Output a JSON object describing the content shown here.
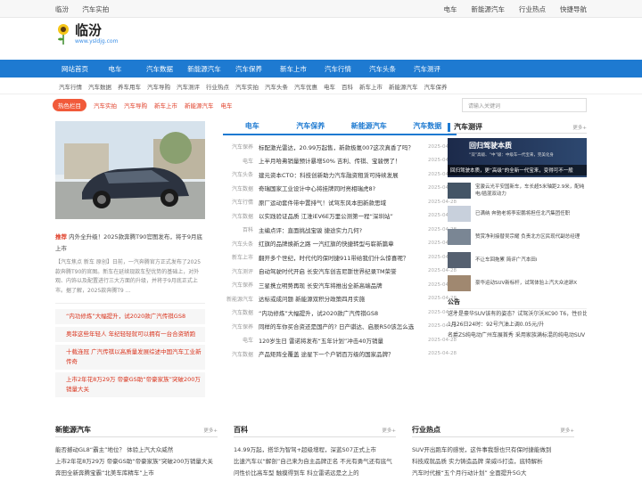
{
  "topbar": {
    "left": [
      "临汾",
      "汽车实拍"
    ],
    "right": [
      "电车",
      "新能源汽车",
      "行业热点",
      "快捷导航"
    ]
  },
  "site": {
    "name": "临汾",
    "url": "www.ysldjg.com"
  },
  "mainnav": [
    "网站首页",
    "电车",
    "汽车数据",
    "新能源汽车",
    "汽车保养",
    "新车上市",
    "汽车行情",
    "汽车头条",
    "汽车测评"
  ],
  "subnav": [
    "汽车行情",
    "汽车数据",
    "养车用车",
    "汽车导购",
    "汽车测评",
    "行业热点",
    "汽车实拍",
    "汽车头条",
    "汽车优惠",
    "电车",
    "百科",
    "新车上市",
    "新能源汽车",
    "汽车保养"
  ],
  "tagrow": {
    "badge": "热色栏目",
    "tags": [
      "汽车实拍",
      "汽车导购",
      "新车上市",
      "新能源汽车",
      "电车"
    ],
    "search_placeholder": "请输入关键词"
  },
  "left": {
    "rec_label": "推荐",
    "headline": "内外全升级！2025款奔腾T90官图发布，将于9月底上市",
    "summary": "【汽车焦点 新车 原创】日前，一汽奔腾官方正式发布了2025款奔腾T90的官图。新车在延续现款车型优势的基础上，对外观、内饰以及配置进行三大方面的升级，并将于9月底正式上市。据了解，2025款奔腾T9 ...",
    "red_items": [
      "“内功修炼”大幅提升，试2020款广汽传祺GS8",
      "奥菲这些年轻人 年纪轻轻就可以拥有一台合资轿跑",
      "十载连冠 广汽传祺以高质量发展综述中国汽车工业新传奇",
      "上市2年花8万29万 帝豪GS助“帝豪家族”突破200万销量大关"
    ]
  },
  "mid": {
    "tabs": [
      "电车",
      "汽车保养",
      "新能源汽车",
      "汽车数据"
    ],
    "rows": [
      {
        "cat": "汽车保养",
        "title": "标配激光雷达，20.99万起售，新款极氪007这次真香了吗？",
        "date": "2025-04-28"
      },
      {
        "cat": "电车",
        "title": "上半月哈弗销量预计暴增50% 吉利、传祺、宝骏愣了！",
        "date": "2025-04-28"
      },
      {
        "cat": "汽车头条",
        "title": "建元资本CTO：科技创新助力汽车融资租赁可持续发展",
        "date": "2025-04-28"
      },
      {
        "cat": "汽车数据",
        "title": "奇瑞国家工业设计中心将挂牌同时亮相瑞虎8?",
        "date": "2025-04-28"
      },
      {
        "cat": "汽车行情",
        "title": "原厂运动套件带中置排气！试驾东风本田新款思域",
        "date": "2025-04-28"
      },
      {
        "cat": "汽车数据",
        "title": "以实践验证品质 江淮iEV6E万里公测第一程“深圳站”",
        "date": "2025-04-28"
      },
      {
        "cat": "百科",
        "title": "主编点评：直面挑战宝骏 捷途实力几何?",
        "date": "2025-04-28"
      },
      {
        "cat": "汽车头条",
        "title": "红旗的品牌焕新之路 一汽红旗的快捷转型与崭新篇章",
        "date": "2025-04-28"
      },
      {
        "cat": "新车上市",
        "title": "翻开多个世纪，时代代的保时捷911带给我们什么惊喜呢？",
        "date": "2025-04-28"
      },
      {
        "cat": "汽车测评",
        "title": "自动驾驶时代开启 长安汽车创吉尼斯世界纪录TM荣誉",
        "date": "2025-04-28"
      },
      {
        "cat": "汽车保养",
        "title": "三星携立明势再现 长安汽车将推出全新高端品牌",
        "date": "2025-04-28"
      },
      {
        "cat": "新能源汽车",
        "title": "达标或成问题 新能源双积分政策四月实施",
        "date": "2025-04-28"
      },
      {
        "cat": "汽车数据",
        "title": "“内功修炼”大幅提升，试2020款广汽传祺GS8",
        "date": "2025-04-28"
      },
      {
        "cat": "汽车保养",
        "title": "同样的车你买合资还是国产的? 日产骐达、启辰R50该怎么选",
        "date": "2025-04-28"
      },
      {
        "cat": "电车",
        "title": "120岁生日 雷诺将发布“五年计划”冲击40万销量",
        "date": "2025-04-28"
      },
      {
        "cat": "汽车数据",
        "title": "产品矩阵全覆盖 途星下一个户销百万级的国家品牌？",
        "date": "2025-04-28"
      }
    ]
  },
  "right": {
    "section_title": "汽车测评",
    "more": "更多+",
    "banner_title": "回归驾驶本质",
    "banner_sub": "“双”高级、“中”级：中级车一代宝来，完美化身",
    "banner_caption": "回归驾驶本质，更“高级”的全新一代宝来，变得可不一般",
    "thumbs": [
      "宝骏云光平安国新车，车长超5米轴距2.9米，配纯电/插混双动力",
      "已满纳 奔驰老将李宏鹏将担任北汽集团任职",
      "赞赏净利接替吴宗耀 负责北方区民现代副总经理",
      "不让车回拖累 简评广汽本田i",
      "豪华运动SUV新标杆，试驾体验上汽大众途昂X"
    ],
    "notice_title": "公告",
    "notices": [
      "这才是豪华SUV该有的姿态？试驾沃尔沃XC90 T6，性价比高还安全",
      "1月26日24时：92号汽油上调0.05元/升",
      "名爵ZS纯电动广州车展首秀 采用家族满标混的纯电动SUV"
    ]
  },
  "bottom": [
    {
      "title": "新能源汽车",
      "more": "更多+",
      "items": [
        "能否撼动GL8“霸主”地位？ 体验上汽大众威然",
        "上市2年花8万29万 帝豪GS助“帝豪家族”突破200万销量大关",
        "奔田全新奔腾宝霸“北美车库精车”上市"
      ]
    },
    {
      "title": "百科",
      "more": "更多+",
      "items": [
        "14.99万起，搭华为智驾+超级增程，深蓝S07正式上市",
        "比速汽车以“解剖”自己来为自主品牌正名 不光有勇气还有底气",
        "问性价比高车型 触摸得到车 科立雷诺远是之上的"
      ]
    },
    {
      "title": "行业热点",
      "more": "更多+",
      "items": [
        "SUV开出跑车的感觉，这件事我想也只有保时捷能做到",
        "科技成就品质 实力铸造品牌 荣威i5打造，底特解析",
        "汽车时代报“五个月行动计划” 全面提升5G大"
      ]
    }
  ]
}
